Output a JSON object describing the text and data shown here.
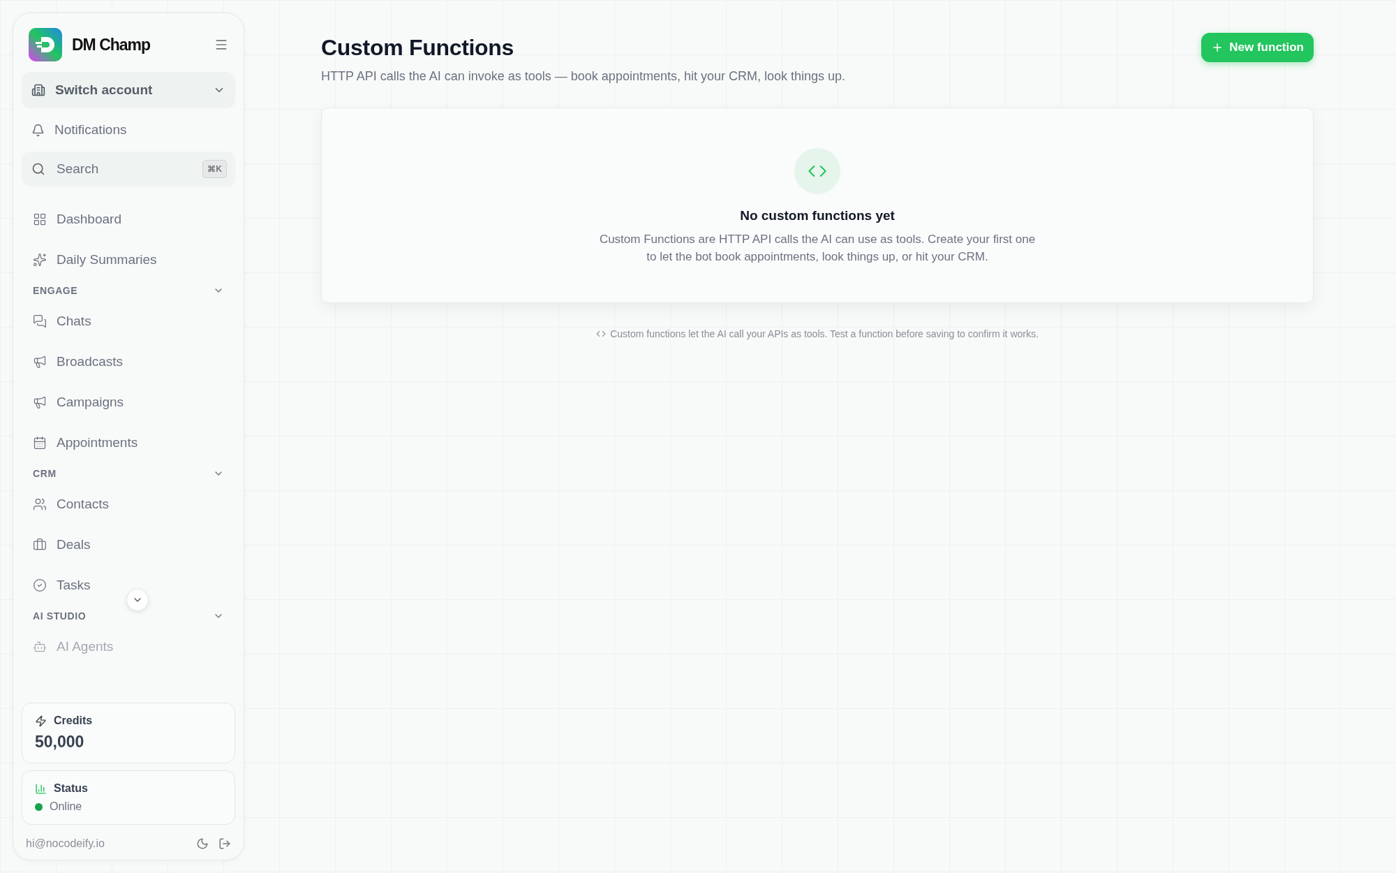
{
  "sidebar": {
    "brand": "DM Champ",
    "account": {
      "label": "Switch account"
    },
    "notifications": "Notifications",
    "search": {
      "placeholder": "Search",
      "shortcut": "⌘K"
    },
    "top_items": [
      "Dashboard",
      "Daily Summaries"
    ],
    "sections": [
      {
        "title": "ENGAGE",
        "expanded": true,
        "items": [
          "Chats",
          "Broadcasts",
          "Campaigns",
          "Appointments"
        ]
      },
      {
        "title": "CRM",
        "expanded": true,
        "items": [
          "Contacts",
          "Deals",
          "Tasks"
        ]
      },
      {
        "title": "AI STUDIO",
        "expanded": true,
        "items": [
          "AI Agents"
        ]
      }
    ],
    "credits": {
      "label": "Credits",
      "value": "50,000"
    },
    "status": {
      "label": "Status",
      "value": "Online",
      "color": "#16a34a"
    },
    "email": "hi@nocodeify.io"
  },
  "header": {
    "title": "Custom Functions",
    "subtitle": "HTTP API calls the AI can invoke as tools — book appointments, hit your CRM, look things up.",
    "button": "New function"
  },
  "empty_state": {
    "title": "No custom functions yet",
    "text": "Custom Functions are HTTP API calls the AI can use as tools. Create your first one to let the bot book appointments, look things up, or hit your CRM."
  },
  "footnote": "Custom functions let the AI call your APIs as tools. Test a function before saving to confirm it works."
}
